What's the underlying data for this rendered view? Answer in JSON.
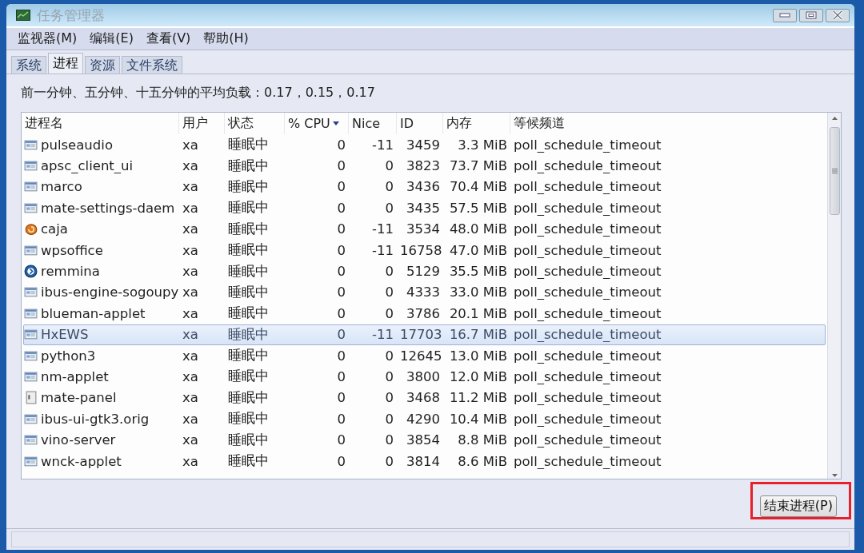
{
  "window": {
    "title": "任务管理器"
  },
  "menu": [
    "监视器(M)",
    "编辑(E)",
    "查看(V)",
    "帮助(H)"
  ],
  "tabs": [
    {
      "label": "系统",
      "selected": false
    },
    {
      "label": "进程",
      "selected": true
    },
    {
      "label": "资源",
      "selected": false
    },
    {
      "label": "文件系统",
      "selected": false
    }
  ],
  "load_average": "前一分钟、五分钟、十五分钟的平均负载：0.17，0.15，0.17",
  "table": {
    "columns": [
      {
        "label": "进程名",
        "sorted": false
      },
      {
        "label": "用户",
        "sorted": false
      },
      {
        "label": "状态",
        "sorted": false
      },
      {
        "label": "% CPU",
        "sorted": true
      },
      {
        "label": "Nice",
        "sorted": false
      },
      {
        "label": "ID",
        "sorted": false
      },
      {
        "label": "内存",
        "sorted": false
      },
      {
        "label": "等候频道",
        "sorted": false
      }
    ],
    "rows": [
      {
        "kind": "window",
        "name": "pulseaudio",
        "user": "xa",
        "status": "睡眠中",
        "cpu": "0",
        "nice": "-11",
        "id": "3459",
        "memory": "3.3 MiB",
        "wait_channel": "poll_schedule_timeout",
        "selected": false
      },
      {
        "kind": "window",
        "name": "apsc_client_ui",
        "user": "xa",
        "status": "睡眠中",
        "cpu": "0",
        "nice": "0",
        "id": "3823",
        "memory": "73.7 MiB",
        "wait_channel": "poll_schedule_timeout",
        "selected": false
      },
      {
        "kind": "window",
        "name": "marco",
        "user": "xa",
        "status": "睡眠中",
        "cpu": "0",
        "nice": "0",
        "id": "3436",
        "memory": "70.4 MiB",
        "wait_channel": "poll_schedule_timeout",
        "selected": false
      },
      {
        "kind": "window",
        "name": "mate-settings-daem",
        "user": "xa",
        "status": "睡眠中",
        "cpu": "0",
        "nice": "0",
        "id": "3435",
        "memory": "57.5 MiB",
        "wait_channel": "poll_schedule_timeout",
        "selected": false
      },
      {
        "kind": "shell",
        "name": "caja",
        "user": "xa",
        "status": "睡眠中",
        "cpu": "0",
        "nice": "-11",
        "id": "3534",
        "memory": "48.0 MiB",
        "wait_channel": "poll_schedule_timeout",
        "selected": false
      },
      {
        "kind": "window",
        "name": "wpsoffice",
        "user": "xa",
        "status": "睡眠中",
        "cpu": "0",
        "nice": "-11",
        "id": "16758",
        "memory": "47.0 MiB",
        "wait_channel": "poll_schedule_timeout",
        "selected": false
      },
      {
        "kind": "disc",
        "name": "remmina",
        "user": "xa",
        "status": "睡眠中",
        "cpu": "0",
        "nice": "0",
        "id": "5129",
        "memory": "35.5 MiB",
        "wait_channel": "poll_schedule_timeout",
        "selected": false
      },
      {
        "kind": "window",
        "name": "ibus-engine-sogoupy",
        "user": "xa",
        "status": "睡眠中",
        "cpu": "0",
        "nice": "0",
        "id": "4333",
        "memory": "33.0 MiB",
        "wait_channel": "poll_schedule_timeout",
        "selected": false
      },
      {
        "kind": "window",
        "name": "blueman-applet",
        "user": "xa",
        "status": "睡眠中",
        "cpu": "0",
        "nice": "0",
        "id": "3786",
        "memory": "20.1 MiB",
        "wait_channel": "poll_schedule_timeout",
        "selected": false
      },
      {
        "kind": "window",
        "name": "HxEWS",
        "user": "xa",
        "status": "睡眠中",
        "cpu": "0",
        "nice": "-11",
        "id": "17703",
        "memory": "16.7 MiB",
        "wait_channel": "poll_schedule_timeout",
        "selected": true
      },
      {
        "kind": "window",
        "name": "python3",
        "user": "xa",
        "status": "睡眠中",
        "cpu": "0",
        "nice": "0",
        "id": "12645",
        "memory": "13.0 MiB",
        "wait_channel": "poll_schedule_timeout",
        "selected": false
      },
      {
        "kind": "window",
        "name": "nm-applet",
        "user": "xa",
        "status": "睡眠中",
        "cpu": "0",
        "nice": "0",
        "id": "3800",
        "memory": "12.0 MiB",
        "wait_channel": "poll_schedule_timeout",
        "selected": false
      },
      {
        "kind": "panel",
        "name": "mate-panel",
        "user": "xa",
        "status": "睡眠中",
        "cpu": "0",
        "nice": "0",
        "id": "3468",
        "memory": "11.2 MiB",
        "wait_channel": "poll_schedule_timeout",
        "selected": false
      },
      {
        "kind": "window",
        "name": "ibus-ui-gtk3.orig",
        "user": "xa",
        "status": "睡眠中",
        "cpu": "0",
        "nice": "0",
        "id": "4290",
        "memory": "10.4 MiB",
        "wait_channel": "poll_schedule_timeout",
        "selected": false
      },
      {
        "kind": "window",
        "name": "vino-server",
        "user": "xa",
        "status": "睡眠中",
        "cpu": "0",
        "nice": "0",
        "id": "3854",
        "memory": "8.8 MiB",
        "wait_channel": "poll_schedule_timeout",
        "selected": false
      },
      {
        "kind": "window",
        "name": "wnck-applet",
        "user": "xa",
        "status": "睡眠中",
        "cpu": "0",
        "nice": "0",
        "id": "3814",
        "memory": "8.6 MiB",
        "wait_channel": "poll_schedule_timeout",
        "selected": false
      }
    ]
  },
  "end_process_button": "结束进程(P)"
}
